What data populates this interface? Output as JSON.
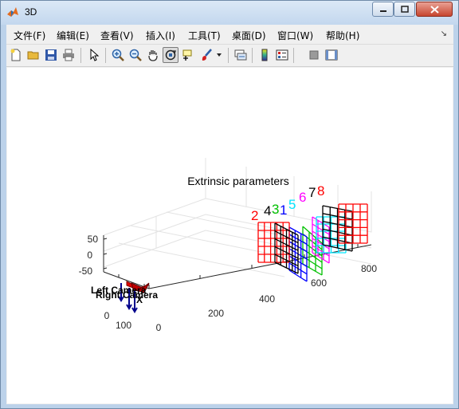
{
  "window": {
    "title": "3D"
  },
  "menu": {
    "items": [
      "文件(F)",
      "编辑(E)",
      "查看(V)",
      "插入(I)",
      "工具(T)",
      "桌面(D)",
      "窗口(W)",
      "帮助(H)"
    ]
  },
  "toolbar": {
    "icons": [
      "new-file-icon",
      "open-folder-icon",
      "save-icon",
      "print-icon",
      "pointer-icon",
      "zoom-in-icon",
      "zoom-out-icon",
      "pan-hand-icon",
      "rotate-3d-icon",
      "data-cursor-icon",
      "brush-icon",
      "link-plot-icon",
      "colorbar-icon",
      "legend-icon",
      "hide-plot-tools-icon",
      "show-plot-tools-icon"
    ]
  },
  "chart_data": {
    "type": "scatter",
    "title": "Extrinsic parameters",
    "y_ticks": [
      "800",
      "600",
      "400",
      "200",
      "0"
    ],
    "x_ticks": [
      "100",
      "0"
    ],
    "z_ticks": [
      "50",
      "0",
      "-50"
    ],
    "camera_labels": [
      "Left Camera",
      "Right Camera"
    ],
    "axis_letter": "X",
    "boards": [
      {
        "label": "2",
        "color": "#ff0000"
      },
      {
        "label": "4",
        "color": "#000000"
      },
      {
        "label": "3",
        "color": "#00c000"
      },
      {
        "label": "1",
        "color": "#0000ff"
      },
      {
        "label": "5",
        "color": "#00e5ff"
      },
      {
        "label": "6",
        "color": "#ff00ff"
      },
      {
        "label": "7",
        "color": "#000000"
      },
      {
        "label": "8",
        "color": "#ff0000"
      }
    ]
  }
}
